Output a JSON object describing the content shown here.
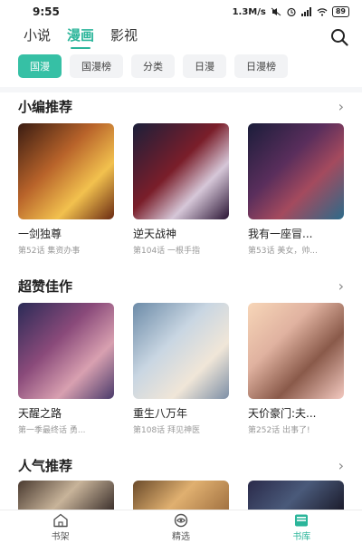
{
  "status_bar": {
    "time": "9:55",
    "speed": "1.3M/s",
    "battery": "89"
  },
  "top_tabs": [
    {
      "label": "小说",
      "active": false
    },
    {
      "label": "漫画",
      "active": true
    },
    {
      "label": "影视",
      "active": false
    }
  ],
  "chips": [
    {
      "label": "国漫",
      "active": true
    },
    {
      "label": "国漫榜",
      "active": false
    },
    {
      "label": "分类",
      "active": false
    },
    {
      "label": "日漫",
      "active": false
    },
    {
      "label": "日漫榜",
      "active": false
    }
  ],
  "sections": [
    {
      "title": "小编推荐",
      "more_icon": "chevron-right-icon",
      "items": [
        {
          "name": "一剑独尊",
          "sub": "第52话 集资办事"
        },
        {
          "name": "逆天战神",
          "sub": "第104话 一根手指"
        },
        {
          "name": "我有一座冒...",
          "sub": "第53话 美女，帅..."
        }
      ]
    },
    {
      "title": "超赞佳作",
      "more_icon": "chevron-right-icon",
      "items": [
        {
          "name": "天醒之路",
          "sub": "第一季最终话 勇..."
        },
        {
          "name": "重生八万年",
          "sub": "第108话 拜见神医"
        },
        {
          "name": "天价豪门:夫...",
          "sub": "第252话 出事了!"
        }
      ]
    },
    {
      "title": "人气推荐",
      "more_icon": "chevron-right-icon",
      "items": []
    }
  ],
  "bottom_nav": [
    {
      "label": "书架",
      "icon": "home-icon",
      "active": false
    },
    {
      "label": "精选",
      "icon": "eye-icon",
      "active": false
    },
    {
      "label": "书库",
      "icon": "library-icon",
      "active": true
    }
  ],
  "colors": {
    "accent": "#2bb59a",
    "chip_active": "#36c0a5"
  }
}
